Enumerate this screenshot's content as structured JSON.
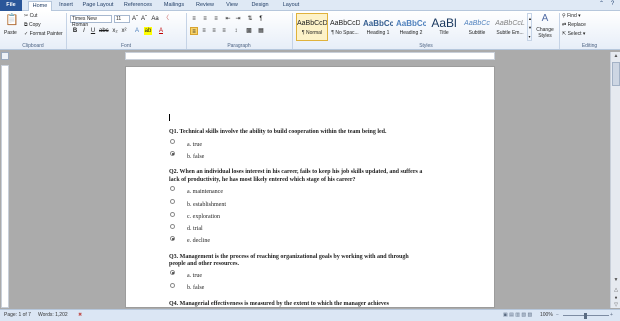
{
  "tabs": [
    "File",
    "Home",
    "Insert",
    "Page Layout",
    "References",
    "Mailings",
    "Review",
    "View",
    "Design",
    "Layout"
  ],
  "clipboard": {
    "paste": "Paste",
    "cut": "Cut",
    "copy": "Copy",
    "format_painter": "Format Painter",
    "label": "Clipboard"
  },
  "font": {
    "name": "Times New Roman",
    "size": "11",
    "label": "Font"
  },
  "paragraph": {
    "label": "Paragraph"
  },
  "styles": {
    "label": "Styles",
    "items": [
      {
        "sample": "AaBbCcDc",
        "name": "¶ Normal"
      },
      {
        "sample": "AaBbCcDc",
        "name": "¶ No Spac..."
      },
      {
        "sample": "AaBbCc",
        "name": "Heading 1"
      },
      {
        "sample": "AaBbCc",
        "name": "Heading 2"
      },
      {
        "sample": "AaBl",
        "name": "Title"
      },
      {
        "sample": "AaBbCc",
        "name": "Subtitle"
      },
      {
        "sample": "AaBbCcL",
        "name": "Subtle Em..."
      }
    ],
    "change_styles": "Change Styles"
  },
  "editing": {
    "find": "Find",
    "replace": "Replace",
    "select": "Select",
    "label": "Editing"
  },
  "document": {
    "q1": "Q1. Technical skills involve the ability to build cooperation within the team being led.",
    "q1_options": [
      "a. true",
      "b. false"
    ],
    "q2_line1": "Q2. When an individual loses interest in his career, fails to keep his job skills updated, and suffers a",
    "q2_line2": "lack of productivity, he has most likely entered which stage of his career?",
    "q2_options": [
      "a. maintenance",
      "b. establishment",
      "c. exploration",
      "d. trial",
      "e. decline"
    ],
    "q3_line1": "Q3. Management is the process of reaching organizational goals by working with and through",
    "q3_line2": "people and other resources.",
    "q3_options": [
      "a. true",
      "b. false"
    ],
    "q4": "Q4. Managerial effectiveness is measured by the extent to which the manager achieves"
  },
  "status": {
    "page": "Page: 1 of 7",
    "words": "Words: 1,202",
    "zoom": "100%"
  }
}
